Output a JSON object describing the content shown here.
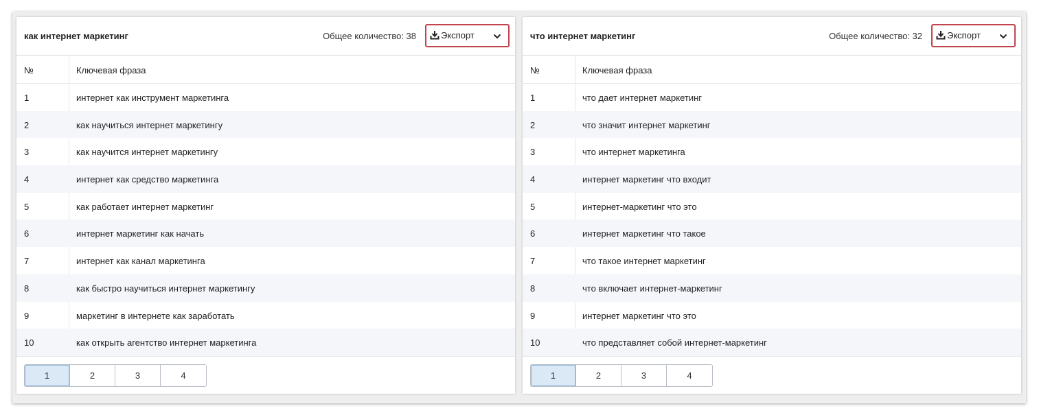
{
  "panels": [
    {
      "title": "как интернет маркетинг",
      "total": "Общее количество: 38",
      "export_label": "Экспорт",
      "columns": {
        "num": "№",
        "phrase": "Ключевая фраза"
      },
      "rows": [
        {
          "num": "1",
          "phrase": "интернет как инструмент маркетинга"
        },
        {
          "num": "2",
          "phrase": "как научиться интернет маркетингу"
        },
        {
          "num": "3",
          "phrase": "как научится интернет маркетингу"
        },
        {
          "num": "4",
          "phrase": "интернет как средство маркетинга"
        },
        {
          "num": "5",
          "phrase": "как работает интернет маркетинг"
        },
        {
          "num": "6",
          "phrase": "интернет маркетинг как начать"
        },
        {
          "num": "7",
          "phrase": "интернет как канал маркетинга"
        },
        {
          "num": "8",
          "phrase": "как быстро научиться интернет маркетингу"
        },
        {
          "num": "9",
          "phrase": "маркетинг в интернете как заработать"
        },
        {
          "num": "10",
          "phrase": "как открыть агентство интернет маркетинга"
        }
      ],
      "pages": [
        "1",
        "2",
        "3",
        "4"
      ],
      "active_page": "1"
    },
    {
      "title": "что интернет маркетинг",
      "total": "Общее количество: 32",
      "export_label": "Экспорт",
      "columns": {
        "num": "№",
        "phrase": "Ключевая фраза"
      },
      "rows": [
        {
          "num": "1",
          "phrase": "что дает интернет маркетинг"
        },
        {
          "num": "2",
          "phrase": "что значит интернет маркетинг"
        },
        {
          "num": "3",
          "phrase": "что интернет маркетинга"
        },
        {
          "num": "4",
          "phrase": "интернет маркетинг что входит"
        },
        {
          "num": "5",
          "phrase": "интернет-маркетинг что это"
        },
        {
          "num": "6",
          "phrase": "интернет маркетинг что такое"
        },
        {
          "num": "7",
          "phrase": "что такое интернет маркетинг"
        },
        {
          "num": "8",
          "phrase": "что включает интернет-маркетинг"
        },
        {
          "num": "9",
          "phrase": "интернет маркетинг что это"
        },
        {
          "num": "10",
          "phrase": "что представляет собой интернет-маркетинг"
        }
      ],
      "pages": [
        "1",
        "2",
        "3",
        "4"
      ],
      "active_page": "1"
    }
  ],
  "icons": {
    "export": "download-icon",
    "dropdown": "chevron-down-icon"
  },
  "colors": {
    "export_border": "#c0454f",
    "active_page_bg": "#dbe9f7",
    "row_alt_bg": "#f4f6fa"
  }
}
